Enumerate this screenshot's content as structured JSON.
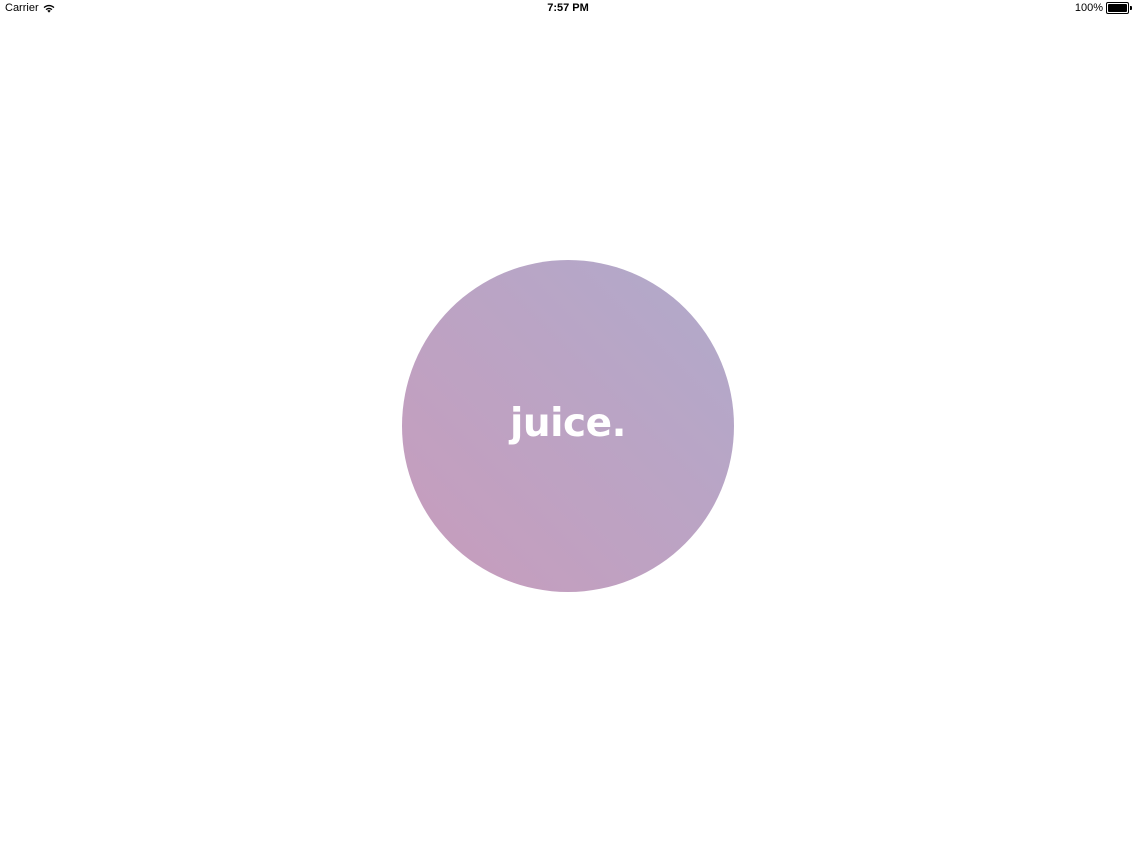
{
  "status_bar": {
    "carrier": "Carrier",
    "time": "7:57 PM",
    "battery_percent": "100%",
    "battery_level": 1.0,
    "icons": {
      "wifi": "wifi-icon",
      "battery": "battery-icon"
    }
  },
  "splash": {
    "logo_text": "juice.",
    "gradient_colors": {
      "top_right": "#b0aacb",
      "bottom_left": "#c89cbc"
    },
    "text_color": "#ffffff"
  },
  "colors": {
    "background": "#ffffff"
  }
}
